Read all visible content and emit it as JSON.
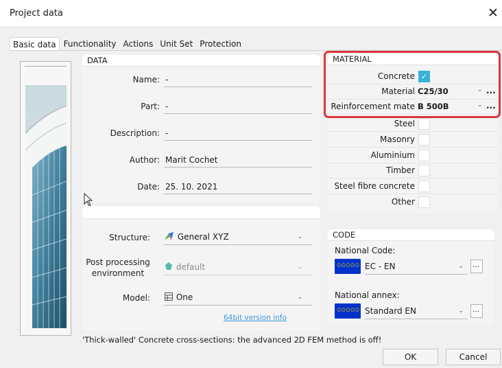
{
  "window": {
    "title": "Project data",
    "close_glyph": "✕"
  },
  "tabs": [
    "Basic data",
    "Functionality",
    "Actions",
    "Unit Set",
    "Protection"
  ],
  "data_panel": {
    "header": "DATA",
    "fields": [
      {
        "label": "Name:",
        "value": "-"
      },
      {
        "label": "Part:",
        "value": "-"
      },
      {
        "label": "Description:",
        "value": "-"
      },
      {
        "label": "Author:",
        "value": "Marit Cochet"
      },
      {
        "label": "Date:",
        "value": "25. 10. 2021"
      }
    ]
  },
  "settings_panel": {
    "structure": {
      "label": "Structure:",
      "value": "General XYZ",
      "icon": "general-xyz-icon"
    },
    "post_processing": {
      "label_line1": "Post processing",
      "label_line2": "environment",
      "value": "default",
      "icon": "default-env-icon",
      "disabled": true
    },
    "model": {
      "label": "Model:",
      "value": "One",
      "icon": "model-one-icon"
    },
    "version_link": "64bit version info"
  },
  "material_panel": {
    "header": "MATERIAL",
    "concrete_label": "Concrete",
    "concrete_checked": true,
    "material_label": "Material",
    "material_value": "C25/30",
    "reinforcement_label": "Reinforcement mate",
    "reinforcement_value": "B 500B",
    "more_glyph": "...",
    "others": [
      {
        "label": "Steel",
        "checked": false
      },
      {
        "label": "Masonry",
        "checked": false
      },
      {
        "label": "Aluminium",
        "checked": false
      },
      {
        "label": "Timber",
        "checked": false
      },
      {
        "label": "Steel fibre concrete",
        "checked": false
      },
      {
        "label": "Other",
        "checked": false
      }
    ]
  },
  "code_panel": {
    "header": "CODE",
    "national_code_label": "National Code:",
    "national_code_value": "EC - EN",
    "national_annex_label": "National annex:",
    "national_annex_value": "Standard EN",
    "flag_stars": "✩✩✩✩✩"
  },
  "status_message": "'Thick-walled' Concrete cross-sections: the advanced 2D FEM method is off!",
  "buttons": {
    "ok": "OK",
    "cancel": "Cancel"
  },
  "colors": {
    "checkbox_accent": "#3ab2d8",
    "highlight_border": "#d9363e",
    "flag_blue": "#0033cc",
    "link": "#3a9ad9"
  }
}
